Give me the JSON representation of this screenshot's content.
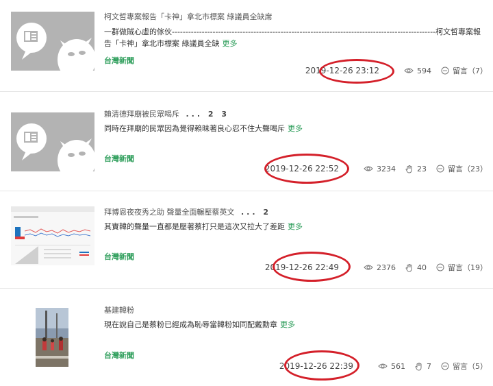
{
  "posts": [
    {
      "title": "柯文哲專案報告「卡神」拿北市標案 綠議員全缺席",
      "pages": "",
      "excerpt": "一群做賊心虛的傢伙-------------------------------------------------------------------------------------------------柯文哲專案報告「卡神」拿北市標案 綠議員全缺",
      "more": "更多",
      "source": "台灣新聞",
      "time": "2019-12-26 23:12",
      "views": "594",
      "likes": "",
      "comments": "留言（7）",
      "thumb": "news-placeholder-icon"
    },
    {
      "title": "賴清德拜廟被民眾喝斥",
      "pages": "... 2 3",
      "excerpt": "同時在拜廟的民眾因為覺得賴昧著良心忍不住大聲喝斥",
      "more": "更多",
      "source": "台灣新聞",
      "time": "2019-12-26 22:52",
      "views": "3234",
      "likes": "23",
      "comments": "留言（23）",
      "thumb": "news-placeholder-icon"
    },
    {
      "title": "拜博恩夜夜秀之助 聲量全面輾壓蔡英文",
      "pages": "... 2",
      "excerpt": "其實韓的聲量一直都是壓著蔡打只是這次又拉大了差距",
      "more": "更多",
      "source": "台灣新聞",
      "time": "2019-12-26 22:49",
      "views": "2376",
      "likes": "40",
      "comments": "留言（19）",
      "thumb": "chart-screenshot"
    },
    {
      "title": "基建韓粉",
      "pages": "",
      "excerpt": "現在說自己是蔡粉已經成為恥辱當韓粉如同配戴勳章",
      "more": "更多",
      "source": "台灣新聞",
      "time": "2019-12-26 22:39",
      "views": "561",
      "likes": "7",
      "comments": "留言（5）",
      "thumb": "street-photo"
    }
  ],
  "colors": {
    "accent_green": "#2e9e5b",
    "annotation_red": "#d4202a"
  }
}
